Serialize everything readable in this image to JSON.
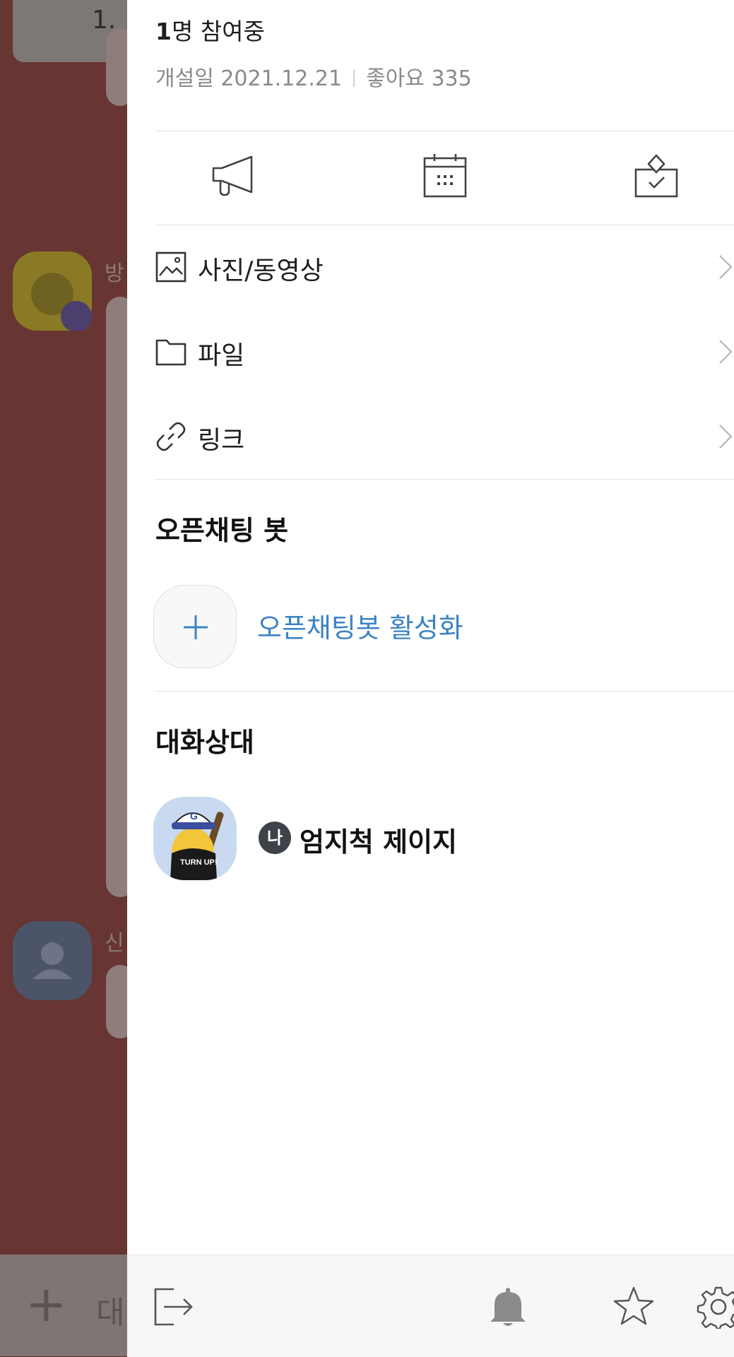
{
  "background_chat": {
    "notice_text": "1.",
    "sender_1_initial": "방",
    "sender_2_initial": "신",
    "input_placeholder": "대"
  },
  "drawer": {
    "members_count": "1",
    "members_suffix": "명 참여중",
    "created_label": "개설일 2021.12.21",
    "likes_label": "좋아요 335",
    "toolbar": {
      "notice_icon": "megaphone-icon",
      "calendar_icon": "calendar-icon",
      "vote_icon": "vote-box-icon"
    },
    "menu": [
      {
        "label": "사진/동영상",
        "icon": "photo-icon"
      },
      {
        "label": "파일",
        "icon": "folder-icon"
      },
      {
        "label": "링크",
        "icon": "link-icon"
      }
    ],
    "bot_section_title": "오픈채팅 봇",
    "bot_activate_label": "오픈채팅봇 활성화",
    "members_section_title": "대화상대",
    "me_badge": "나",
    "member_name": "엄지척 제이지",
    "avatar_text": "TURN UP!",
    "bottom_bar": {
      "exit_icon": "exit-icon",
      "bell_icon": "bell-icon",
      "star_icon": "star-icon",
      "settings_icon": "gear-icon"
    }
  },
  "colors": {
    "accent_link": "#3b83c3",
    "overlay_bg": "#673532",
    "badge": "#3e4249"
  }
}
